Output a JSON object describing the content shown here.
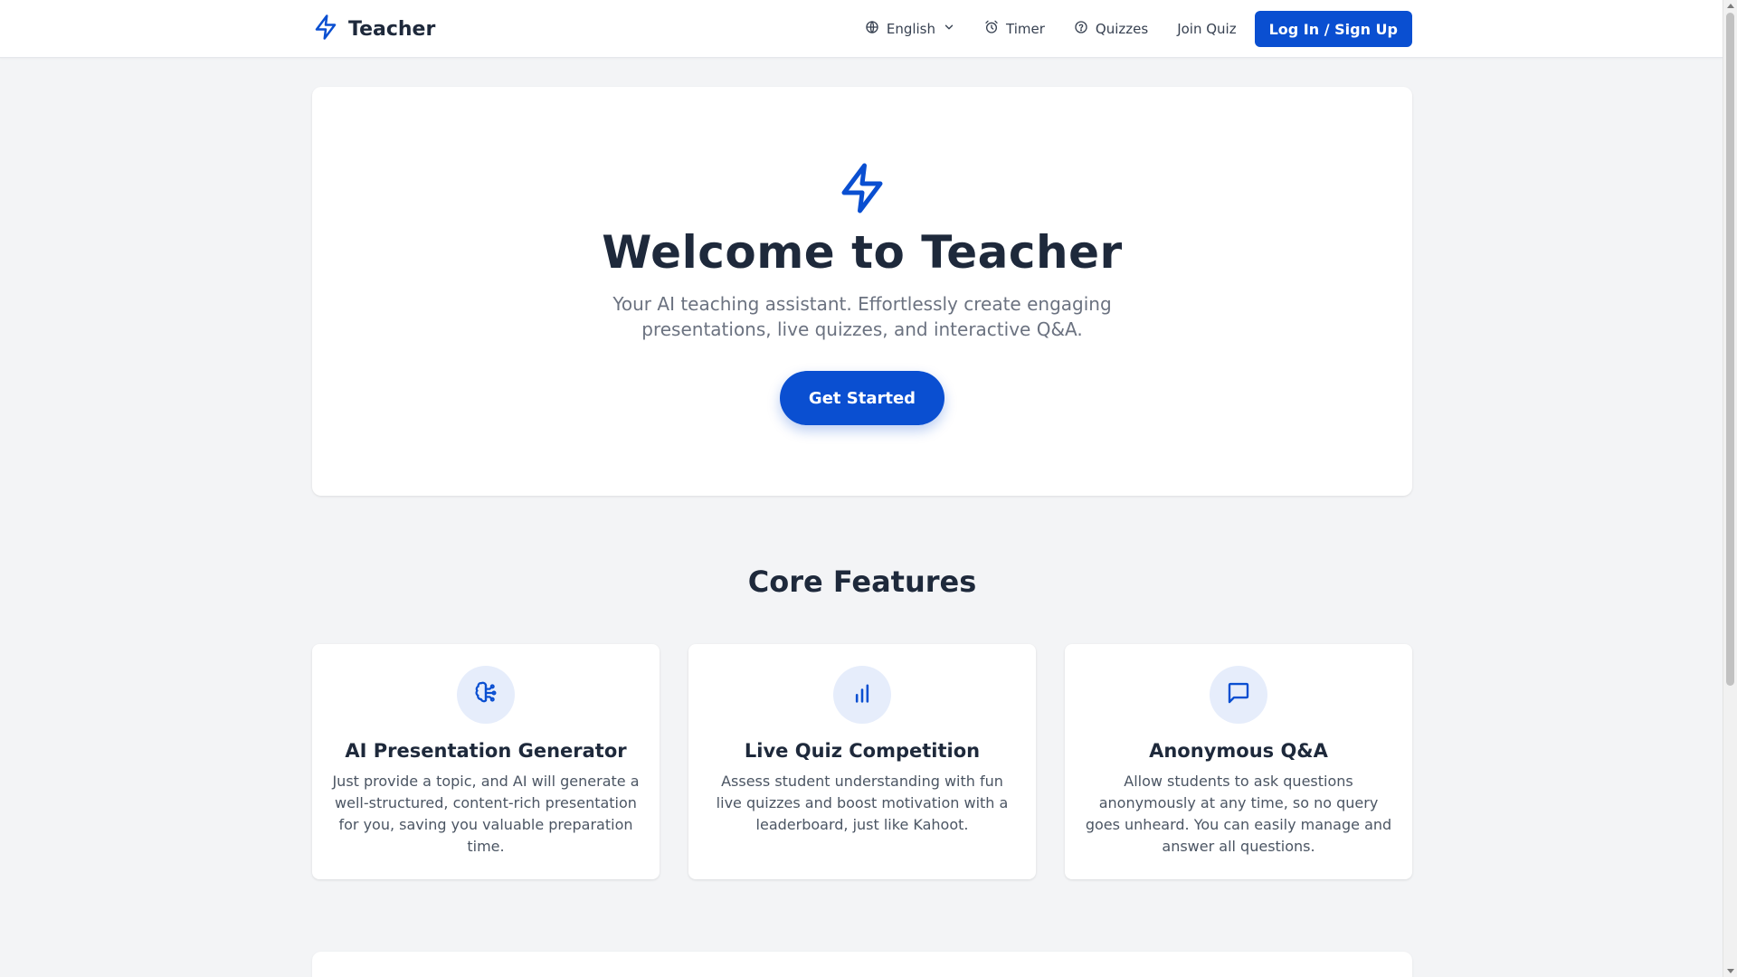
{
  "header": {
    "brand": "Teacher",
    "nav": {
      "language": "English",
      "timer": "Timer",
      "quizzes": "Quizzes",
      "join_quiz": "Join Quiz"
    },
    "login_label": "Log In / Sign Up"
  },
  "hero": {
    "title": "Welcome to Teacher",
    "subtitle": "Your AI teaching assistant. Effortlessly create engaging presentations, live quizzes, and interactive Q&A.",
    "cta_label": "Get Started"
  },
  "features": {
    "title": "Core Features",
    "items": [
      {
        "title": "AI Presentation Generator",
        "description": "Just provide a topic, and AI will generate a well-structured, content-rich presentation for you, saving you valuable preparation time.",
        "icon": "brain-circuit-icon"
      },
      {
        "title": "Live Quiz Competition",
        "description": "Assess student understanding with fun live quizzes and boost motivation with a leaderboard, just like Kahoot.",
        "icon": "bar-chart-icon"
      },
      {
        "title": "Anonymous Q&A",
        "description": "Allow students to ask questions anonymously at any time, so no query goes unheard. You can easily manage and answer all questions.",
        "icon": "message-square-icon"
      }
    ]
  },
  "colors": {
    "primary": "#0a4fd1",
    "text_dark": "#1e293b",
    "text_muted": "#6b7280",
    "background": "#f3f4f6",
    "icon_bg": "#e6edfb"
  }
}
